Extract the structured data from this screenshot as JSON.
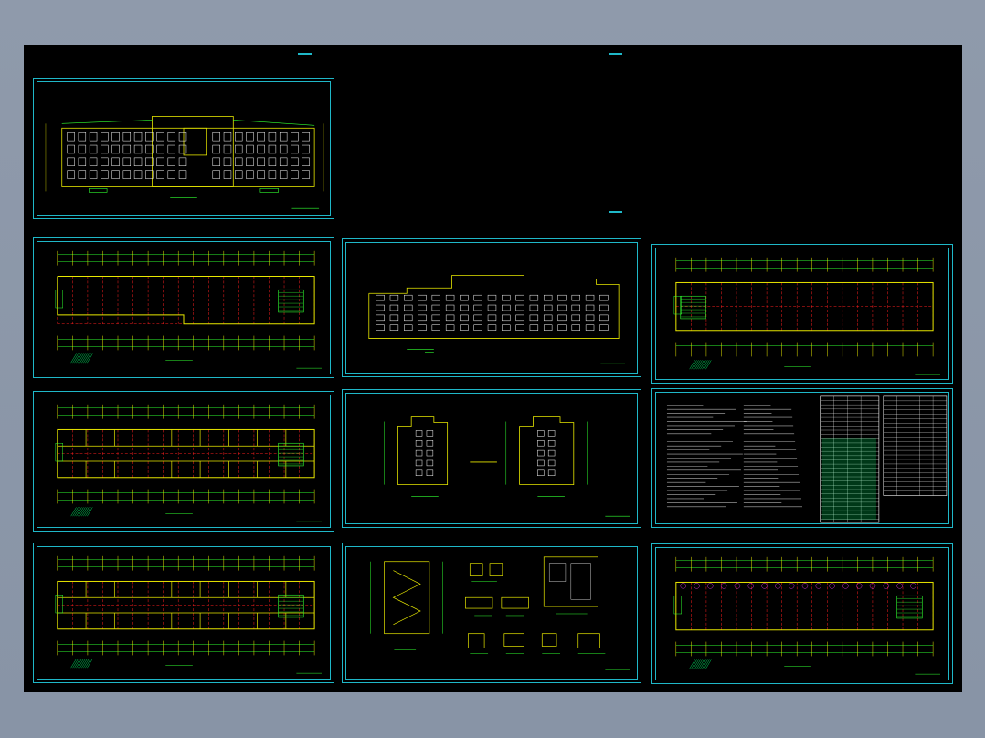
{
  "canvas": {
    "background": "#000000",
    "frame_color": "#1fb8c8"
  },
  "colors": {
    "wall": "#e8e800",
    "grid": "#ff2020",
    "dim": "#30ff30",
    "window": "#ffffff",
    "hatch": "#00e060",
    "accent": "#ff40ff"
  },
  "sheets": [
    {
      "id": "elevation-front",
      "kind": "front-elevation"
    },
    {
      "id": "floor-plan-1",
      "kind": "floor-plan"
    },
    {
      "id": "elevation-rear",
      "kind": "rear-elevation"
    },
    {
      "id": "floor-plan-2",
      "kind": "floor-plan"
    },
    {
      "id": "floor-plan-3",
      "kind": "floor-plan"
    },
    {
      "id": "side-elevations",
      "kind": "side-elevation"
    },
    {
      "id": "notes-tables",
      "kind": "notes"
    },
    {
      "id": "floor-plan-4",
      "kind": "floor-plan"
    },
    {
      "id": "details",
      "kind": "details"
    },
    {
      "id": "floor-plan-5",
      "kind": "floor-plan"
    }
  ]
}
